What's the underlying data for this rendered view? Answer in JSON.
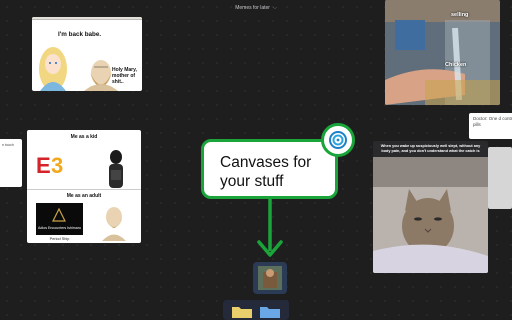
{
  "header": {
    "canvas_name": "Memes for later",
    "dropdown_icon": "chevron-down-icon"
  },
  "cards": {
    "back_babe": {
      "line1": "I'm back babe.",
      "line2": "Holy Mary, mother of shit.."
    },
    "e3_meme": {
      "top_label": "Me as a kid",
      "bottom_label": "Me as an adult",
      "logo_caption": "Adios Encounters Ishimaru",
      "sub_caption": "Period Ship"
    },
    "edge_note": {
      "text": "n touch"
    },
    "water_meme": {
      "label1": "selling",
      "label2": "Chicken"
    },
    "doctor_note": {
      "text": "Doctor: One d control pills"
    },
    "cat_meme": {
      "caption": "When you wake up suspiciously well slept, without any body pain, and you don't understand what the catch is"
    }
  },
  "callout": {
    "text_line1": "Canvases for",
    "text_line2": "your stuff",
    "badge_icon": "canvas-logo-icon"
  },
  "dock": {
    "items": [
      "yellow-folder-icon",
      "blue-folder-icon"
    ]
  },
  "colors": {
    "accent": "#1aa43a",
    "background": "#1e1e1f"
  }
}
